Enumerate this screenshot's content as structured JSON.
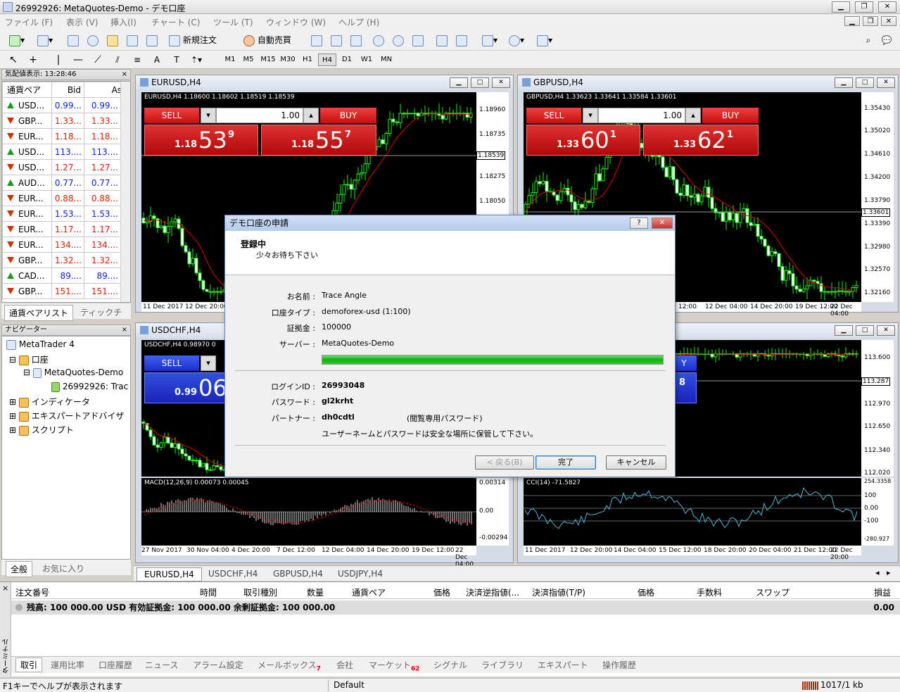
{
  "window": {
    "title": "26992926: MetaQuotes-Demo - デモ口座"
  },
  "menu": [
    "ファイル (F)",
    "表示 (V)",
    "挿入(I)",
    "チャート (C)",
    "ツール (T)",
    "ウィンドウ (W)",
    "ヘルプ (H)"
  ],
  "toolbar": {
    "new_order": "新規注文",
    "auto_trade": "自動売買"
  },
  "timeframes": [
    "M1",
    "M5",
    "M15",
    "M30",
    "H1",
    "H4",
    "D1",
    "W1",
    "MN"
  ],
  "active_timeframe": "H4",
  "market_watch": {
    "title": "気配値表示: 13:28:46",
    "cols": [
      "通貨ペア",
      "Bid",
      "Ask"
    ],
    "rows": [
      {
        "sym": "USD...",
        "bid": "0.99...",
        "ask": "0.99...",
        "dir": "up",
        "color": "blue"
      },
      {
        "sym": "GBP...",
        "bid": "1.33...",
        "ask": "1.33...",
        "dir": "down",
        "color": "red"
      },
      {
        "sym": "EUR...",
        "bid": "1.18...",
        "ask": "1.18...",
        "dir": "down",
        "color": "red"
      },
      {
        "sym": "USD...",
        "bid": "113....",
        "ask": "113....",
        "dir": "up",
        "color": "blue"
      },
      {
        "sym": "USD...",
        "bid": "1.27...",
        "ask": "1.27...",
        "dir": "down",
        "color": "red"
      },
      {
        "sym": "AUD...",
        "bid": "0.77...",
        "ask": "0.77...",
        "dir": "up",
        "color": "blue"
      },
      {
        "sym": "EUR...",
        "bid": "0.88...",
        "ask": "0.88...",
        "dir": "down",
        "color": "red"
      },
      {
        "sym": "EUR...",
        "bid": "1.53...",
        "ask": "1.53...",
        "dir": "down",
        "color": "blue"
      },
      {
        "sym": "EUR...",
        "bid": "1.17...",
        "ask": "1.17...",
        "dir": "down",
        "color": "red"
      },
      {
        "sym": "EUR...",
        "bid": "134....",
        "ask": "134....",
        "dir": "down",
        "color": "red"
      },
      {
        "sym": "GBP...",
        "bid": "1.32...",
        "ask": "1.32...",
        "dir": "down",
        "color": "red"
      },
      {
        "sym": "CAD...",
        "bid": "89....",
        "ask": "89....",
        "dir": "up",
        "color": "blue"
      },
      {
        "sym": "GBP...",
        "bid": "151....",
        "ask": "151....",
        "dir": "down",
        "color": "red"
      }
    ],
    "tabs": [
      "通貨ペアリスト",
      "ティックチ"
    ]
  },
  "navigator": {
    "title": "ナビゲーター",
    "items": [
      "MetaTrader 4",
      "口座",
      "MetaQuotes-Demo",
      "26992926: Trac",
      "インディケータ",
      "エキスパートアドバイザ",
      "スクリプト"
    ],
    "tabs": [
      "全般",
      "お気に入り"
    ]
  },
  "charts": {
    "eurusd": {
      "title": "EURUSD,H4",
      "info": "EURUSD,H4  1.18600 1.18602 1.18519 1.18539",
      "sell": "SELL",
      "buy": "BUY",
      "lot": "1.00",
      "sell_small": "1.18",
      "sell_big": "53",
      "sell_sup": "9",
      "buy_small": "1.18",
      "buy_big": "55",
      "buy_sup": "7",
      "prices": [
        "1.18960",
        "1.18735",
        "1.18539",
        "1.18275",
        "1.18050"
      ],
      "dates": [
        "11 Dec 2017",
        "12 Dec 20:00"
      ]
    },
    "gbpusd": {
      "title": "GBPUSD,H4",
      "info": "GBPUSD,H4  1.33623 1.33641 1.33584 1.33601",
      "sell": "SELL",
      "buy": "BUY",
      "lot": "1.00",
      "sell_small": "1.33",
      "sell_big": "60",
      "sell_sup": "1",
      "buy_small": "1.33",
      "buy_big": "62",
      "buy_sup": "1",
      "prices": [
        "1.35430",
        "1.35020",
        "1.34610",
        "1.34200",
        "1.33790",
        "1.33601",
        "1.33390",
        "1.32980",
        "1.32570",
        "1.32160"
      ],
      "dates": [
        "12:00",
        "12 Dec 04:00",
        "14 Dec 20:00",
        "19 Dec 12:00",
        "22 Dec 04:00"
      ]
    },
    "usdchf": {
      "title": "USDCHF,H4",
      "info": "USDCHF,H4  0.98970 0",
      "sell": "SELL",
      "sell_small": "0.99",
      "sell_big": "06",
      "macd": "MACD(12,26,9) 0.00073 0.00045",
      "macd_scale": [
        "0.00314",
        "0.00",
        "-0.00294"
      ],
      "dates": [
        "27 Nov 2017",
        "30 Nov 04:00",
        "4 Dec 20:00",
        "7 Dec 12:00",
        "12 Dec 04:00",
        "14 Dec 20:00",
        "19 Dec 12:00",
        "22 Dec 04:00"
      ]
    },
    "usdjpy": {
      "buy_partial": "Y",
      "buy_sup": "8",
      "prices": [
        "113.600",
        "113.287",
        "112.970",
        "112.650",
        "112.340",
        "112.020"
      ],
      "cci": "CCI(14) -71.5827",
      "cci_scale": [
        "254.3358",
        "100",
        "0.00",
        "-100",
        "-280.927"
      ],
      "dates": [
        "11 Dec 2017",
        "12 Dec 20:00",
        "14 Dec 04:00",
        "15 Dec 12:00",
        "18 Dec 20:00",
        "20 Dec 04:00",
        "21 Dec 12:00",
        "22 Dec 20:00"
      ]
    }
  },
  "chart_tabs": [
    "EURUSD,H4",
    "USDCHF,H4",
    "GBPUSD,H4",
    "USDJPY,H4"
  ],
  "dialog": {
    "title": "デモ口座の申請",
    "heading": "登録中",
    "sub": "少々お待ち下さい",
    "labels": {
      "name": "お名前 :",
      "type": "口座タイプ :",
      "deposit": "証拠金 :",
      "server": "サーバー :",
      "login": "ログインID :",
      "password": "パスワード :",
      "investor": "パートナー :"
    },
    "values": {
      "name": "Trace Angle",
      "type": "demoforex-usd (1:100)",
      "deposit": "100000",
      "server": "MetaQuotes-Demo",
      "login": "26993048",
      "password": "gl2krht",
      "investor": "dh0cdtl",
      "investor_note": "(閲覧専用パスワード)"
    },
    "note": "ユーザーネームとパスワードは安全な場所に保管して下さい。",
    "progress": 1.0,
    "buttons": {
      "back": "< 戻る(B)",
      "finish": "完了",
      "cancel": "キャンセル"
    }
  },
  "terminal": {
    "cols": [
      "注文番号",
      "時間",
      "取引種別",
      "数量",
      "通貨ペア",
      "価格",
      "決済逆指値(...",
      "決済指値(T/P)",
      "価格",
      "手数料",
      "スワップ",
      "損益"
    ],
    "balance": "残高: 100 000.00 USD  有効証拠金: 100 000.00  余剰証拠金: 100 000.00",
    "profit": "0.00",
    "side": "ターミナル",
    "tabs": [
      {
        "label": "取引"
      },
      {
        "label": "運用比率"
      },
      {
        "label": "口座履歴"
      },
      {
        "label": "ニュース"
      },
      {
        "label": "アラーム設定"
      },
      {
        "label": "メールボックス",
        "badge": "7"
      },
      {
        "label": "会社"
      },
      {
        "label": "マーケット",
        "badge": "62"
      },
      {
        "label": "シグナル"
      },
      {
        "label": "ライブラリ"
      },
      {
        "label": "エキスパート"
      },
      {
        "label": "操作履歴"
      }
    ]
  },
  "status": {
    "help": "F1キーでヘルプが表示されます",
    "profile": "Default",
    "traffic": "1017/1 kb"
  }
}
